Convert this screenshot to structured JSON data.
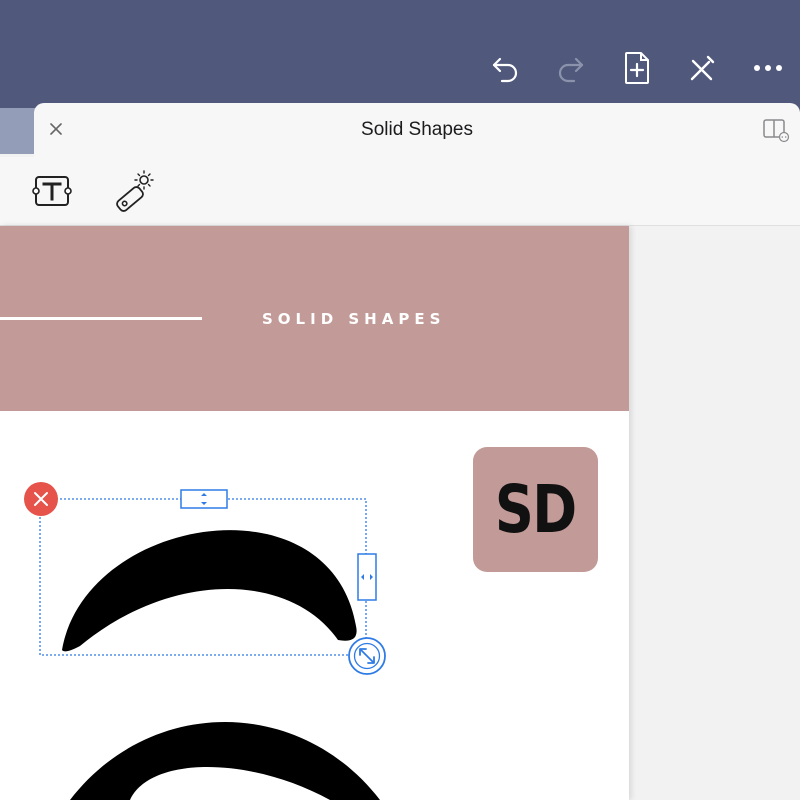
{
  "app": {
    "sheet_title": "Solid Shapes"
  },
  "topbar": {
    "icons": [
      "undo-icon",
      "redo-icon",
      "add-page-icon",
      "pen-tool-icon",
      "more-icon"
    ],
    "redo_enabled": false
  },
  "toolbar": {
    "tools": [
      "text-box-tool-icon",
      "shape-tool-icon"
    ]
  },
  "page": {
    "banner_text": "SOLID SHAPES",
    "logo_text": "SD",
    "colors": {
      "banner": "#c29a97",
      "shape": "#000000",
      "selection": "#2f7be5",
      "delete": "#e5534b",
      "topbar": "#50597c"
    }
  }
}
